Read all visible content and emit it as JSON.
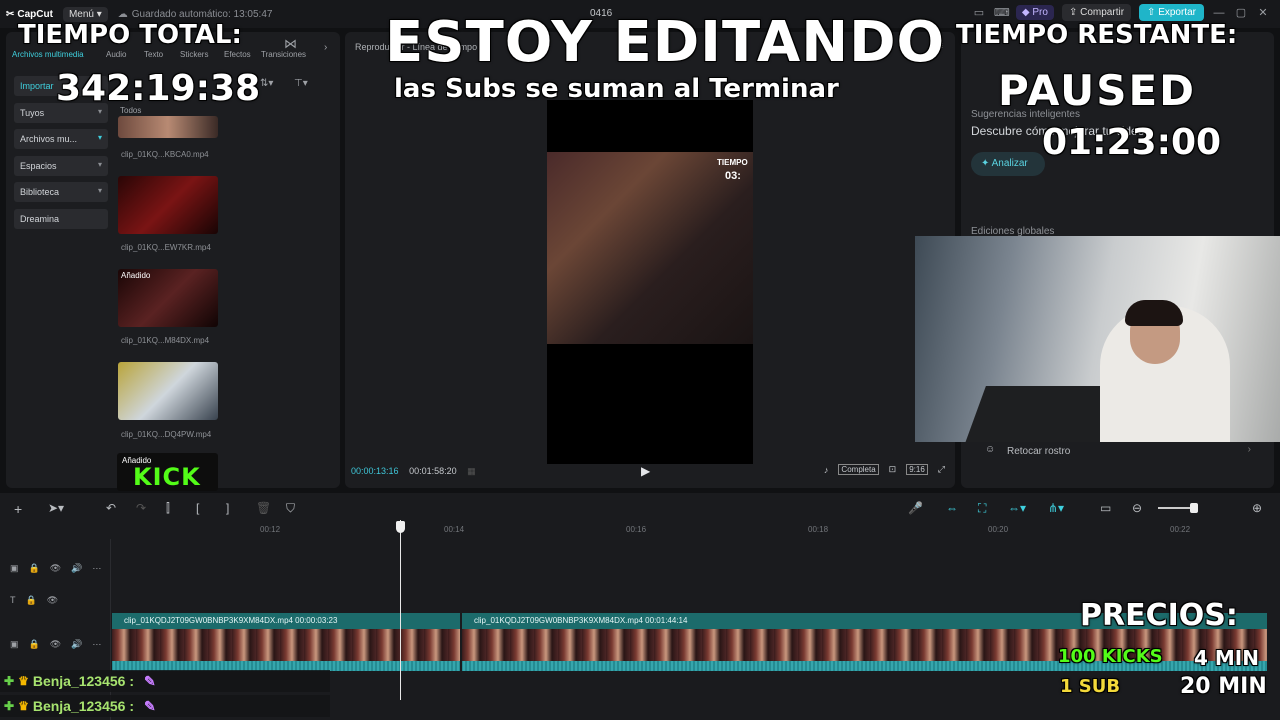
{
  "titlebar": {
    "logo": "CapCut",
    "menu": "Menú",
    "autosave": "Guardado automático: 13:05:47",
    "project": "0416",
    "pro": "Pro",
    "share": "Compartir",
    "export": "Exportar"
  },
  "left_panel": {
    "tabs": [
      "Archivos multimedia",
      "Audio",
      "Texto",
      "Stickers",
      "Efectos",
      "Transiciones"
    ],
    "nav": [
      "Importar",
      "Tuyos",
      "Archivos mu...",
      "Espacios",
      "Biblioteca",
      "Dreamina"
    ],
    "all_label": "Todos",
    "thumbs": [
      {
        "name": "clip_01KQ...KBCA0.mp4",
        "added": ""
      },
      {
        "name": "clip_01KQ...EW7KR.mp4",
        "added": ""
      },
      {
        "name": "clip_01KQ...M84DX.mp4",
        "added": "Añadido"
      },
      {
        "name": "clip_01KQ...DQ4PW.mp4",
        "added": ""
      }
    ],
    "last_added": "Añadido",
    "kick_badge": "KICK"
  },
  "player": {
    "header": "Reproductor - Línea de tiempo",
    "video_overlay_label": "TIEMPO",
    "video_overlay_time": "03:",
    "current_time": "00:00:13:16",
    "total_time": "00:01:58:20",
    "complete": "Completa",
    "ratio": "9:16"
  },
  "right_panel": {
    "suggestions": "Sugerencias inteligentes",
    "description": "Descubre cómo mejorar tu video",
    "analyze": "Analizar",
    "global_edits": "Ediciones globales",
    "retouch": "Retocar rostro"
  },
  "timeline": {
    "ruler": [
      "00:12",
      "00:14",
      "00:16",
      "00:18",
      "00:20",
      "00:22"
    ],
    "clip1_label": "clip_01KQDJ2T09GW0BNBP3K9XM84DX.mp4   00:00:03:23",
    "clip2_label": "clip_01KQDJ2T09GW0BNBP3K9XM84DX.mp4   00:01:44:14"
  },
  "overlay": {
    "total_time_label": "TIEMPO TOTAL:",
    "total_time_value": "342:19:38",
    "main_title": "ESTOY EDITANDO",
    "subtitle": "las Subs se suman al Terminar",
    "remaining_label": "TIEMPO RESTANTE:",
    "paused": "PAUSED",
    "remaining_time": "01:23:00",
    "prices_label": "PRECIOS:",
    "price_kicks": "100 KICKS",
    "price_kicks_time": "4 MIN",
    "price_sub": "1 SUB",
    "price_sub_time": "20 MIN"
  },
  "chat": [
    {
      "user": "Benja_123456 :"
    },
    {
      "user": "Benja_123456 :"
    }
  ],
  "colors": {
    "accent": "#1fb5c9",
    "kick_green": "#53fc18",
    "sub_yellow": "#f3d93a"
  }
}
